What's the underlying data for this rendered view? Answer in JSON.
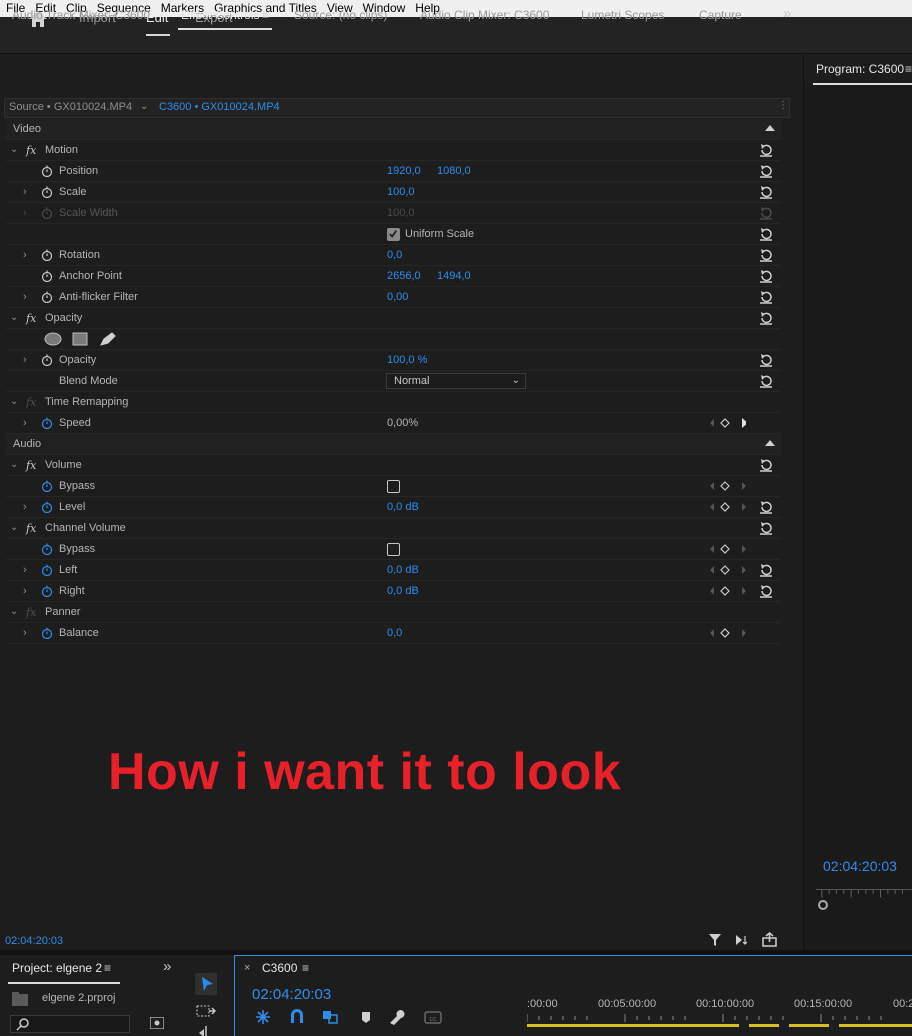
{
  "menu": [
    "File",
    "Edit",
    "Clip",
    "Sequence",
    "Markers",
    "Graphics and Titles",
    "View",
    "Window",
    "Help"
  ],
  "workspace": {
    "import": "Import",
    "edit": "Edit",
    "export": "Export"
  },
  "panel_tabs": {
    "audio_track_mixer": "Audio Track Mixer: C3600",
    "effect_controls": "Effect Controls",
    "source": "Source: (no clips)",
    "audio_clip_mixer": "Audio Clip Mixer: C3600",
    "lumetri_scopes": "Lumetri Scopes",
    "capture": "Capture",
    "more": "»",
    "menu": "≡"
  },
  "program": {
    "tab": "Program: C3600",
    "timecode": "02:04:20:03"
  },
  "ec": {
    "source_label": "Source • GX010024.MP4",
    "clip_label": "C3600 • GX010024.MP4",
    "video": "Video",
    "audio": "Audio",
    "motion": "Motion",
    "position": "Position",
    "position_x": "1920,0",
    "position_y": "1080,0",
    "scale": "Scale",
    "scale_val": "100,0",
    "scale_width": "Scale Width",
    "scale_width_val": "100,0",
    "uniform_scale": "Uniform Scale",
    "rotation": "Rotation",
    "rotation_val": "0,0",
    "anchor": "Anchor Point",
    "anchor_x": "2656,0",
    "anchor_y": "1494,0",
    "antiflicker": "Anti-flicker Filter",
    "antiflicker_val": "0,00",
    "opacity_effect": "Opacity",
    "opacity": "Opacity",
    "opacity_val": "100,0 %",
    "blend_mode": "Blend Mode",
    "blend_val": "Normal",
    "time_remap": "Time Remapping",
    "speed": "Speed",
    "speed_val": "0,00%",
    "volume": "Volume",
    "bypass": "Bypass",
    "level": "Level",
    "level_val": "0,0 dB",
    "channel_volume": "Channel Volume",
    "left": "Left",
    "left_val": "0,0 dB",
    "right": "Right",
    "right_val": "0,0 dB",
    "panner": "Panner",
    "balance": "Balance",
    "balance_val": "0,0",
    "timecode": "02:04:20:03"
  },
  "caption": "How i want it to look",
  "project": {
    "tab": "Project: elgene 2",
    "file": "elgene 2.prproj"
  },
  "timeline": {
    "close": "×",
    "tab": "C3600",
    "timecode": "02:04:20:03",
    "ticks": [
      ":00:00",
      "00:05:00:00",
      "00:10:00:00",
      "00:15:00:00",
      "00:2"
    ]
  },
  "colors": {
    "accent": "#2d8ceb",
    "caption": "#e8202a",
    "panel_bg": "#1d1d1d"
  }
}
